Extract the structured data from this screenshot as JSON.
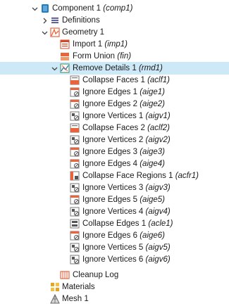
{
  "tree": {
    "component": {
      "label": "Component 1",
      "tag": "(comp1)",
      "icon": "component-icon"
    },
    "definitions": {
      "label": "Definitions",
      "icon": "definitions-icon"
    },
    "geometry": {
      "label": "Geometry 1",
      "icon": "geometry-icon"
    },
    "import": {
      "label": "Import 1",
      "tag": "(imp1)",
      "icon": "import-icon"
    },
    "form_union": {
      "label": "Form Union",
      "tag": "(fin)",
      "icon": "form-union-icon"
    },
    "remove_details": {
      "label": "Remove Details 1",
      "tag": "(rmd1)",
      "icon": "remove-details-icon"
    },
    "children": [
      {
        "label": "Collapse Faces 1",
        "tag": "(aclf1)",
        "icon": "collapse-faces-icon"
      },
      {
        "label": "Ignore Edges 1",
        "tag": "(aige1)",
        "icon": "ignore-edges-icon"
      },
      {
        "label": "Ignore Edges 2",
        "tag": "(aige2)",
        "icon": "ignore-edges-icon"
      },
      {
        "label": "Ignore Vertices 1",
        "tag": "(aigv1)",
        "icon": "ignore-vertices-icon"
      },
      {
        "label": "Collapse Faces 2",
        "tag": "(aclf2)",
        "icon": "collapse-faces-icon"
      },
      {
        "label": "Ignore Vertices 2",
        "tag": "(aigv2)",
        "icon": "ignore-vertices-icon"
      },
      {
        "label": "Ignore Edges 3",
        "tag": "(aige3)",
        "icon": "ignore-edges-icon"
      },
      {
        "label": "Ignore Edges 4",
        "tag": "(aige4)",
        "icon": "ignore-edges-icon"
      },
      {
        "label": "Collapse Face Regions 1",
        "tag": "(acfr1)",
        "icon": "collapse-face-regions-icon"
      },
      {
        "label": "Ignore Vertices 3",
        "tag": "(aigv3)",
        "icon": "ignore-vertices-icon"
      },
      {
        "label": "Ignore Edges 5",
        "tag": "(aige5)",
        "icon": "ignore-edges-icon"
      },
      {
        "label": "Ignore Vertices 4",
        "tag": "(aigv4)",
        "icon": "ignore-vertices-icon"
      },
      {
        "label": "Collapse Edges 1",
        "tag": "(acle1)",
        "icon": "collapse-edges-icon"
      },
      {
        "label": "Ignore Edges 6",
        "tag": "(aige6)",
        "icon": "ignore-edges-icon"
      },
      {
        "label": "Ignore Vertices 5",
        "tag": "(aigv5)",
        "icon": "ignore-vertices-icon"
      },
      {
        "label": "Ignore Vertices 6",
        "tag": "(aigv6)",
        "icon": "ignore-vertices-icon"
      }
    ],
    "cleanup_log": {
      "label": "Cleanup Log",
      "icon": "cleanup-log-icon"
    },
    "materials": {
      "label": "Materials",
      "icon": "materials-icon"
    },
    "mesh": {
      "label": "Mesh 1",
      "icon": "mesh-icon"
    }
  },
  "colors": {
    "selection": "#cde8f7",
    "accent_orange": "#e8643c",
    "accent_blue": "#2a7ab8"
  }
}
